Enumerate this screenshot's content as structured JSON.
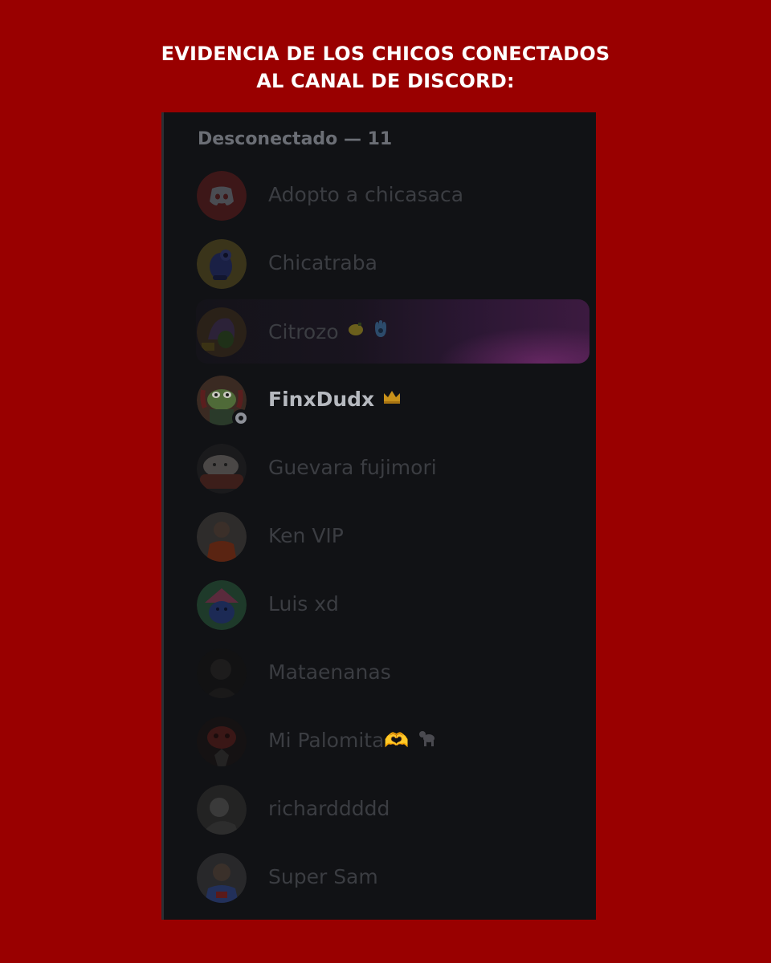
{
  "headline": {
    "line1": "EVIDENCIA DE LOS CHICOS CONECTADOS",
    "line2": "AL CANAL DE DISCORD:"
  },
  "member_list": {
    "section_header": "Desconectado — 11",
    "members": [
      {
        "name": "Adopto a chicasaca",
        "avatar": "discord-logo-avatar",
        "active": false
      },
      {
        "name": "Chicatraba",
        "avatar": "blue-creature-avatar",
        "active": false
      },
      {
        "name": "Citrozo",
        "avatar": "cartoon-character-avatar",
        "active": false,
        "badges": [
          "lemon-emoji",
          "hamsa-emoji"
        ],
        "has_banner": true
      },
      {
        "name": "FinxDudx",
        "avatar": "frog-avatar",
        "active": true,
        "badges": [
          "crown-emoji"
        ],
        "status": "offline"
      },
      {
        "name": "Guevara fujimori",
        "avatar": "dog-avatar",
        "active": false
      },
      {
        "name": "Ken VIP",
        "avatar": "person-photo-avatar",
        "active": false
      },
      {
        "name": "Luis xd",
        "avatar": "pink-blue-cartoon-avatar",
        "active": false
      },
      {
        "name": "Mataenanas",
        "avatar": "dark-photo-avatar",
        "active": false
      },
      {
        "name": "Mi Palomita🫶",
        "avatar": "red-photo-avatar",
        "active": false,
        "badges": [
          "poodle-emoji"
        ]
      },
      {
        "name": "richarddddd",
        "avatar": "grayscale-photo-avatar",
        "active": false
      },
      {
        "name": "Super Sam",
        "avatar": "person-photo-avatar",
        "active": false
      }
    ]
  },
  "colors": {
    "background": "#990000",
    "panel": "#111215",
    "dim_text": "#3b3d42",
    "active_text": "#b6b9bf",
    "header_text": "#6b6e75"
  }
}
